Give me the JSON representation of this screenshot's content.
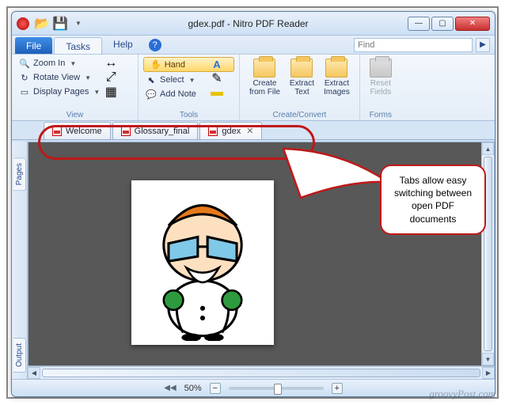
{
  "titlebar": {
    "title": "gdex.pdf - Nitro PDF Reader"
  },
  "win": {
    "min": "—",
    "max": "▢",
    "close": "✕"
  },
  "menu": {
    "file": "File",
    "tasks": "Tasks",
    "help": "Help",
    "find_placeholder": "Find"
  },
  "ribbon": {
    "view": {
      "zoom_in": "Zoom In",
      "rotate": "Rotate View",
      "display_pages": "Display Pages",
      "label": "View"
    },
    "tools": {
      "hand": "Hand",
      "select": "Select",
      "add_note": "Add Note",
      "label": "Tools"
    },
    "create": {
      "create": "Create\nfrom File",
      "extract_text": "Extract\nText",
      "extract_images": "Extract\nImages",
      "label": "Create/Convert"
    },
    "forms": {
      "reset": "Reset\nFields",
      "label": "Forms"
    }
  },
  "tabs": [
    {
      "label": "Welcome"
    },
    {
      "label": "Glossary_final"
    },
    {
      "label": "gdex"
    }
  ],
  "side": {
    "pages": "Pages",
    "output": "Output"
  },
  "status": {
    "zoom": "50%"
  },
  "callout": {
    "text": "Tabs allow easy switching between open PDF documents"
  },
  "watermark": "groovyPost.com"
}
